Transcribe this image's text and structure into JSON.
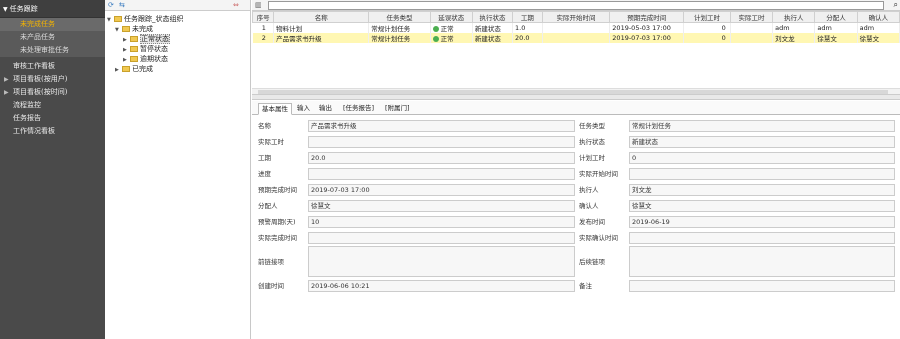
{
  "sidebar": {
    "header": "任务跟踪",
    "subitems": [
      "未完成任务",
      "未产品任务",
      "未处理审批任务"
    ],
    "items": [
      "审核工作看板",
      "项目看板(按用户)",
      "项目看板(按时间)",
      "流程监控",
      "任务报告",
      "工作情况看板"
    ]
  },
  "tree": {
    "root": "任务跟踪_状态组织",
    "nodes": [
      "未完成",
      "正常状态",
      "暂停状态",
      "逾期状态",
      "已完成"
    ]
  },
  "grid": {
    "columns": [
      "序号",
      "名称",
      "任务类型",
      "延误状态",
      "执行状态",
      "工期",
      "实际开始时间",
      "预期完成时间",
      "计划工时",
      "实际工时",
      "执行人",
      "分配人",
      "确认人"
    ],
    "rows": [
      {
        "no": "1",
        "name": "物料计划",
        "type": "常规计划任务",
        "delay": "正常",
        "exec": "新建状态",
        "dur": "1.0",
        "start": "",
        "due": "2019-05-03 17:00",
        "plan": "0",
        "actual": "",
        "executor": "adm",
        "assigner": "adm",
        "confirmer": "adm"
      },
      {
        "no": "2",
        "name": "产品需求书升级",
        "type": "常规计划任务",
        "delay": "正常",
        "exec": "新建状态",
        "dur": "20.0",
        "start": "",
        "due": "2019-07-03 17:00",
        "plan": "0",
        "actual": "",
        "executor": "刘文龙",
        "assigner": "徐慧文",
        "confirmer": "徐慧文"
      }
    ]
  },
  "tabs": [
    "基本属性",
    "输入",
    "输出",
    "[任务报告]",
    "[附属门]"
  ],
  "form": {
    "name_label": "名称",
    "name_value": "产品需求书升级",
    "task_type_label": "任务类型",
    "task_type_value": "常规计划任务",
    "actual_hours_label": "实际工时",
    "actual_hours_value": "",
    "exec_status_label": "执行状态",
    "exec_status_value": "新建状态",
    "duration_label": "工期",
    "duration_value": "20.0",
    "plan_hours_label": "计划工时",
    "plan_hours_value": "0",
    "progress_label": "进度",
    "progress_value": "",
    "actual_start_label": "实际开始时间",
    "actual_start_value": "",
    "due_label": "预期完成时间",
    "due_value": "2019-07-03 17:00",
    "executor_label": "执行人",
    "executor_value": "刘文龙",
    "assigner_label": "分配人",
    "assigner_value": "徐慧文",
    "confirmer_label": "确认人",
    "confirmer_value": "徐慧文",
    "warning_label": "预警周期(天)",
    "warning_value": "10",
    "release_label": "发布时间",
    "release_value": "2019-06-19",
    "actual_complete_label": "实际完成时间",
    "actual_complete_value": "",
    "actual_confirm_label": "实际确认时间",
    "actual_confirm_value": "",
    "prev_link_label": "前链接项",
    "prev_link_value": "",
    "next_link_label": "后续链项",
    "next_link_value": "",
    "created_label": "创建时间",
    "created_value": "2019-06-06 10:21",
    "remark_label": "备注",
    "remark_value": ""
  }
}
